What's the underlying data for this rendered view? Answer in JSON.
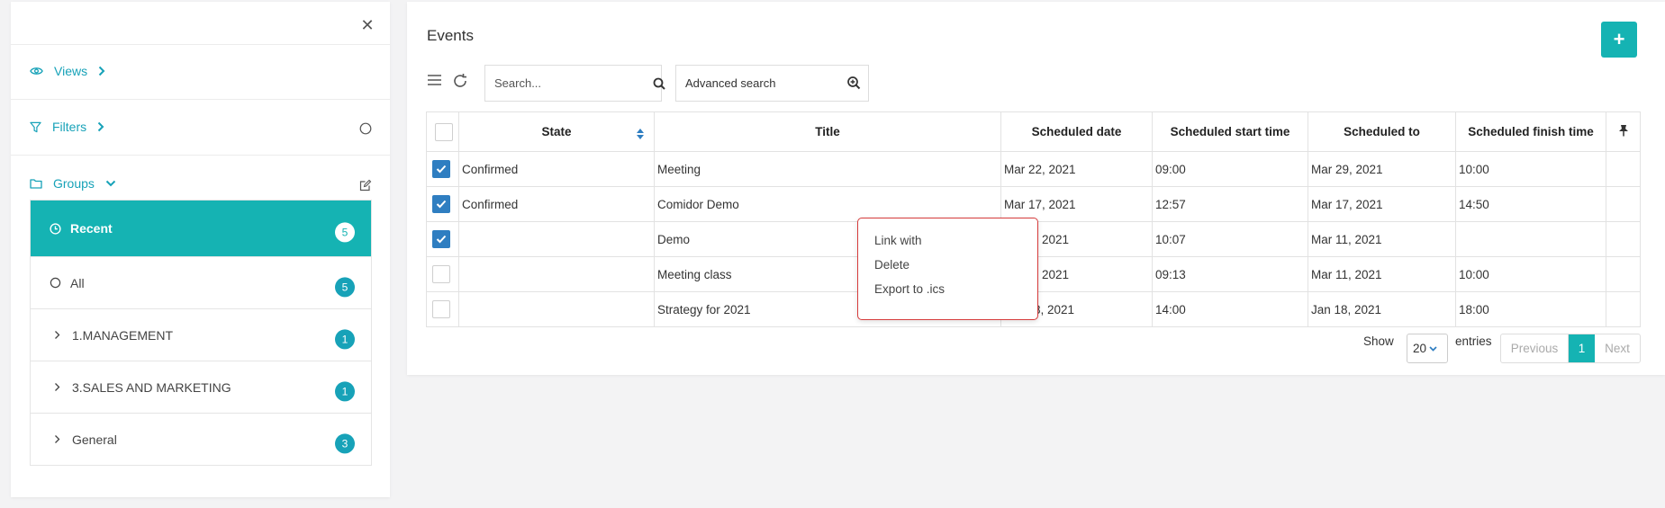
{
  "sidebar": {
    "views_label": "Views",
    "filters_label": "Filters",
    "groups_label": "Groups",
    "groups": [
      {
        "label": "Recent",
        "count": "5"
      },
      {
        "label": "All",
        "count": "5"
      },
      {
        "label": "1.MANAGEMENT",
        "count": "1"
      },
      {
        "label": "3.SALES AND MARKETING",
        "count": "1"
      },
      {
        "label": "General",
        "count": "3"
      }
    ]
  },
  "main": {
    "title": "Events",
    "add_label": "+",
    "search_placeholder": "Search...",
    "advanced_search_label": "Advanced search",
    "columns": [
      "State",
      "Title",
      "Scheduled date",
      "Scheduled start time",
      "Scheduled to",
      "Scheduled finish time"
    ],
    "rows": [
      {
        "checked": true,
        "state": "Confirmed",
        "title": "Meeting",
        "date": "Mar 22, 2021",
        "start": "09:00",
        "to": "Mar 29, 2021",
        "finish": "10:00"
      },
      {
        "checked": true,
        "state": "Confirmed",
        "title": "Comidor Demo",
        "date": "Mar 17, 2021",
        "start": "12:57",
        "to": "Mar 17, 2021",
        "finish": "14:50"
      },
      {
        "checked": true,
        "state": "",
        "title": "Demo",
        "date": "Mar 4, 2021",
        "start": "10:07",
        "to": "Mar 11, 2021",
        "finish": ""
      },
      {
        "checked": false,
        "state": "",
        "title": "Meeting class",
        "date": "Mar 4, 2021",
        "start": "09:13",
        "to": "Mar 11, 2021",
        "finish": "10:00"
      },
      {
        "checked": false,
        "state": "",
        "title": "Strategy for 2021",
        "date": "Jan 18, 2021",
        "start": "14:00",
        "to": "Jan 18, 2021",
        "finish": "18:00"
      }
    ],
    "context_menu": [
      "Link with",
      "Delete",
      "Export to .ics"
    ],
    "footer": {
      "show_label": "Show",
      "page_size": "20",
      "entries_label": "entries",
      "previous_label": "Previous",
      "current_page": "1",
      "next_label": "Next"
    }
  },
  "colors": {
    "accent": "#15b3b3",
    "checkbox": "#2f7ec1",
    "highlight_border": "#d63b3b"
  }
}
